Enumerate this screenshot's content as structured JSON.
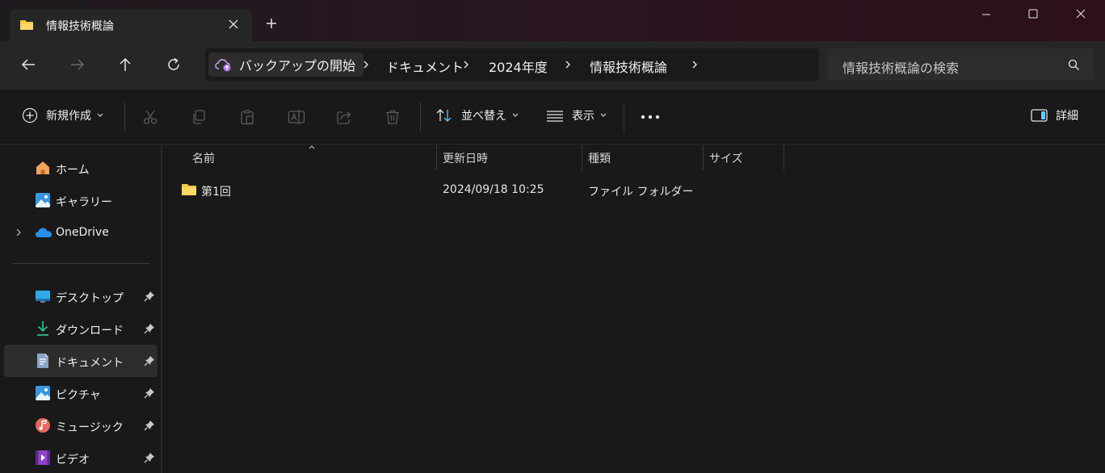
{
  "tab": {
    "title": "情報技術概論"
  },
  "breadcrumb": {
    "home": "バックアップの開始",
    "items": [
      "ドキュメント",
      "2024年度",
      "情報技術概論"
    ]
  },
  "search": {
    "placeholder": "情報技術概論の検索"
  },
  "toolbar": {
    "new_label": "新規作成",
    "sort_label": "並べ替え",
    "view_label": "表示",
    "details_label": "詳細"
  },
  "sidebar": {
    "items": [
      {
        "label": "ホーム",
        "icon": "home-icon"
      },
      {
        "label": "ギャラリー",
        "icon": "gallery-icon"
      },
      {
        "label": "OneDrive",
        "icon": "onedrive-icon"
      }
    ],
    "quick_access": [
      {
        "label": "デスクトップ",
        "icon": "desktop-icon",
        "pinned": true
      },
      {
        "label": "ダウンロード",
        "icon": "download-icon",
        "pinned": true
      },
      {
        "label": "ドキュメント",
        "icon": "documents-icon",
        "pinned": true,
        "selected": true
      },
      {
        "label": "ピクチャ",
        "icon": "pictures-icon",
        "pinned": true
      },
      {
        "label": "ミュージック",
        "icon": "music-icon",
        "pinned": true
      },
      {
        "label": "ビデオ",
        "icon": "video-icon",
        "pinned": true
      }
    ]
  },
  "columns": [
    "名前",
    "更新日時",
    "種類",
    "サイズ"
  ],
  "files": [
    {
      "name": "第1回",
      "modified": "2024/09/18 10:25",
      "type": "ファイル フォルダー",
      "size": ""
    }
  ],
  "colors": {
    "accent": "#60cdff",
    "folder": "#f8c94a",
    "background": "#191919"
  }
}
